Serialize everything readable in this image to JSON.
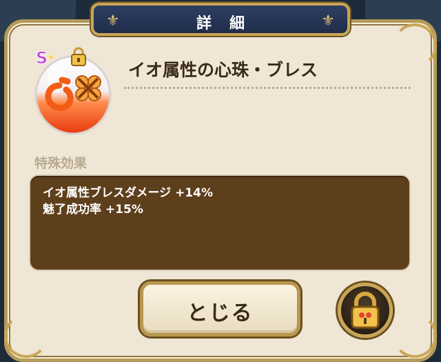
{
  "dialog": {
    "title": "詳細",
    "item_name": "イオ属性の心珠・ブレス",
    "section_label": "特殊効果",
    "effects": [
      "イオ属性ブレスダメージ +14%",
      "魅了成功率 +15%"
    ],
    "item_badge": "S",
    "close_label": "とじる"
  },
  "icons": {
    "item": "orb-egg-icon",
    "lock": "padlock-icon",
    "flourish": "fleur-de-lis-icon"
  },
  "colors": {
    "panel": "#efe6d6",
    "effect_box": "#5e3f1c",
    "title_plate": "#2e3f63",
    "gold_trim": "#c9a656"
  }
}
